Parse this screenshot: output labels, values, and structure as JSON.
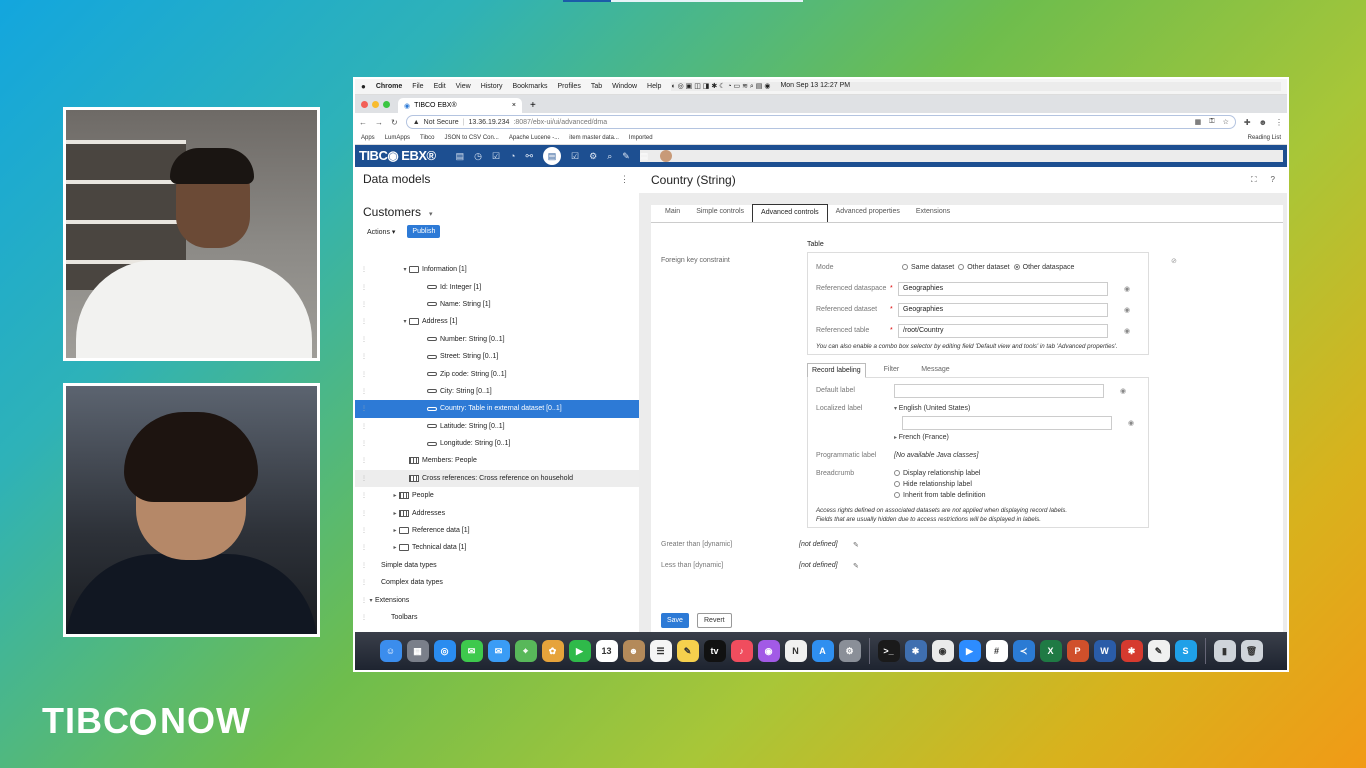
{
  "brand": {
    "text": "TIBC",
    "now": "NOW"
  },
  "macbar": {
    "apple": "",
    "menus": [
      "Chrome",
      "File",
      "Edit",
      "View",
      "History",
      "Bookmarks",
      "Profiles",
      "Tab",
      "Window",
      "Help"
    ],
    "datetime": "Mon Sep 13  12:27 PM"
  },
  "browser": {
    "tab_title": "TIBCO EBX®",
    "tab_close": "×",
    "new_tab": "+",
    "not_secure": "Not Secure",
    "url_host": "13.36.19.234",
    "url_path": ":8087/ebx-ui/ui/advanced/dma",
    "bookmarks": [
      "Apps",
      "LumApps",
      "Tibco",
      "JSON to CSV Con...",
      "Apache Lucene -...",
      "item master data...",
      "Imported"
    ],
    "reading_list": "Reading List"
  },
  "ebx": {
    "logo": "TIBC◉ EBX®"
  },
  "left": {
    "title": "Data models",
    "dataset": "Customers",
    "actions_label": "Actions ▾",
    "publish_label": "Publish",
    "tree": [
      {
        "indent": 46,
        "tw": "▾",
        "icon": "folder",
        "label": "Information [1]"
      },
      {
        "indent": 64,
        "tw": "",
        "icon": "field",
        "label": "Id: Integer  [1]"
      },
      {
        "indent": 64,
        "tw": "",
        "icon": "field",
        "label": "Name: String  [1]"
      },
      {
        "indent": 46,
        "tw": "▾",
        "icon": "folder",
        "label": "Address [1]"
      },
      {
        "indent": 64,
        "tw": "",
        "icon": "field",
        "label": "Number: String  [0..1]"
      },
      {
        "indent": 64,
        "tw": "",
        "icon": "field",
        "label": "Street: String  [0..1]"
      },
      {
        "indent": 64,
        "tw": "",
        "icon": "field",
        "label": "Zip code: String  [0..1]"
      },
      {
        "indent": 64,
        "tw": "",
        "icon": "field",
        "label": "City: String  [0..1]"
      },
      {
        "indent": 64,
        "tw": "",
        "icon": "field",
        "label": "Country: Table in external dataset  [0..1]",
        "sel": true
      },
      {
        "indent": 64,
        "tw": "",
        "icon": "field",
        "label": "Latitude: String  [0..1]"
      },
      {
        "indent": 64,
        "tw": "",
        "icon": "field",
        "label": "Longitude: String  [0..1]"
      },
      {
        "indent": 46,
        "tw": "",
        "icon": "table",
        "label": "Members: People"
      },
      {
        "indent": 46,
        "tw": "",
        "icon": "table",
        "label": "Cross references: Cross reference on household",
        "hover": true
      },
      {
        "indent": 36,
        "tw": "▸",
        "icon": "table",
        "label": "People"
      },
      {
        "indent": 36,
        "tw": "▸",
        "icon": "table",
        "label": "Addresses"
      },
      {
        "indent": 36,
        "tw": "▸",
        "icon": "folder",
        "label": "Reference data [1]"
      },
      {
        "indent": 36,
        "tw": "▸",
        "icon": "folder",
        "label": "Technical data [1]"
      },
      {
        "indent": 18,
        "tw": "",
        "icon": "",
        "label": "Simple data types"
      },
      {
        "indent": 18,
        "tw": "",
        "icon": "",
        "label": "Complex data types"
      },
      {
        "indent": 12,
        "tw": "▾",
        "icon": "",
        "label": "Extensions"
      },
      {
        "indent": 28,
        "tw": "",
        "icon": "",
        "label": "Toolbars"
      }
    ]
  },
  "right": {
    "title": "Country (String)",
    "tabs": [
      "Main",
      "Simple controls",
      "Advanced controls",
      "Advanced properties",
      "Extensions"
    ],
    "fk_label": "Foreign key constraint",
    "table_title": "Table",
    "mode_label": "Mode",
    "mode_options": [
      "Same dataset",
      "Other dataset",
      "Other dataspace"
    ],
    "ref_dataspace_label": "Referenced dataspace",
    "ref_dataspace_value": "Geographies",
    "ref_dataset_label": "Referenced dataset",
    "ref_dataset_value": "Geographies",
    "ref_table_label": "Referenced table",
    "ref_table_value": "/root/Country",
    "required_mark": "*",
    "note": "You can also enable a combo box selector by editing field 'Default view and tools' in tab 'Advanced properties'.",
    "subtabs": [
      "Record labeling",
      "Filter",
      "Message"
    ],
    "default_label": "Default label",
    "localized_label": "Localized label",
    "lang1": "English (United States)",
    "lang2": "French (France)",
    "programmatic_label": "Programmatic label",
    "programmatic_value": "[No available Java classes]",
    "breadcrumb_label": "Breadcrumb",
    "breadcrumb_options": [
      "Display relationship label",
      "Hide relationship label",
      "Inherit from table definition"
    ],
    "access_note1": "Access rights defined on associated datasets are not applied when displaying record labels.",
    "access_note2": "Fields that are usually hidden due to access restrictions will be displayed in labels.",
    "greater_label": "Greater than [dynamic]",
    "less_label": "Less than [dynamic]",
    "not_defined": "[not defined]",
    "save_label": "Save",
    "revert_label": "Revert"
  },
  "dock": {
    "apps": [
      {
        "name": "finder",
        "color": "#3b8ded",
        "glyph": "☺"
      },
      {
        "name": "launchpad",
        "color": "#7a7f8a",
        "glyph": "▦"
      },
      {
        "name": "safari",
        "color": "#2a8cf0",
        "glyph": "◎"
      },
      {
        "name": "messages",
        "color": "#3ec94d",
        "glyph": "✉"
      },
      {
        "name": "mail",
        "color": "#3a9cf5",
        "glyph": "✉"
      },
      {
        "name": "maps",
        "color": "#58b85a",
        "glyph": "⌖"
      },
      {
        "name": "photos",
        "color": "#e6a33b",
        "glyph": "✿"
      },
      {
        "name": "facetime",
        "color": "#2fba4a",
        "glyph": "▶"
      },
      {
        "name": "calendar",
        "color": "#ffffff",
        "glyph": "13"
      },
      {
        "name": "contacts",
        "color": "#b48a5a",
        "glyph": "☻"
      },
      {
        "name": "reminders",
        "color": "#f5f5f5",
        "glyph": "☰"
      },
      {
        "name": "notes",
        "color": "#f6d04d",
        "glyph": "✎"
      },
      {
        "name": "tv",
        "color": "#111111",
        "glyph": "tv"
      },
      {
        "name": "music",
        "color": "#f04d5e",
        "glyph": "♪"
      },
      {
        "name": "podcasts",
        "color": "#a25ae6",
        "glyph": "◉"
      },
      {
        "name": "news",
        "color": "#f0f0f0",
        "glyph": "N"
      },
      {
        "name": "app-store",
        "color": "#2f8ff0",
        "glyph": "A"
      },
      {
        "name": "system-preferences",
        "color": "#8a8f98",
        "glyph": "⚙"
      },
      {
        "name": "terminal",
        "color": "#1a1a1a",
        "glyph": ">_"
      },
      {
        "name": "network-utility",
        "color": "#3f6fb0",
        "glyph": "✱"
      },
      {
        "name": "chrome",
        "color": "#eaeaea",
        "glyph": "◉"
      },
      {
        "name": "zoom",
        "color": "#2d8cff",
        "glyph": "▶"
      },
      {
        "name": "slack",
        "color": "#ffffff",
        "glyph": "#"
      },
      {
        "name": "vscode",
        "color": "#2b7bd4",
        "glyph": "≺"
      },
      {
        "name": "excel",
        "color": "#1f7a44",
        "glyph": "X"
      },
      {
        "name": "powerpoint",
        "color": "#d0502b",
        "glyph": "P"
      },
      {
        "name": "word",
        "color": "#2a5ca8",
        "glyph": "W"
      },
      {
        "name": "compass-app",
        "color": "#d63a2f",
        "glyph": "✱"
      },
      {
        "name": "script-editor",
        "color": "#f0f0f0",
        "glyph": "✎"
      },
      {
        "name": "skype",
        "color": "#1fa0e8",
        "glyph": "S"
      },
      {
        "name": "downloads",
        "color": "#cfd4da",
        "glyph": "▮"
      },
      {
        "name": "trash",
        "color": "#cfd4da",
        "glyph": "🗑"
      }
    ]
  }
}
